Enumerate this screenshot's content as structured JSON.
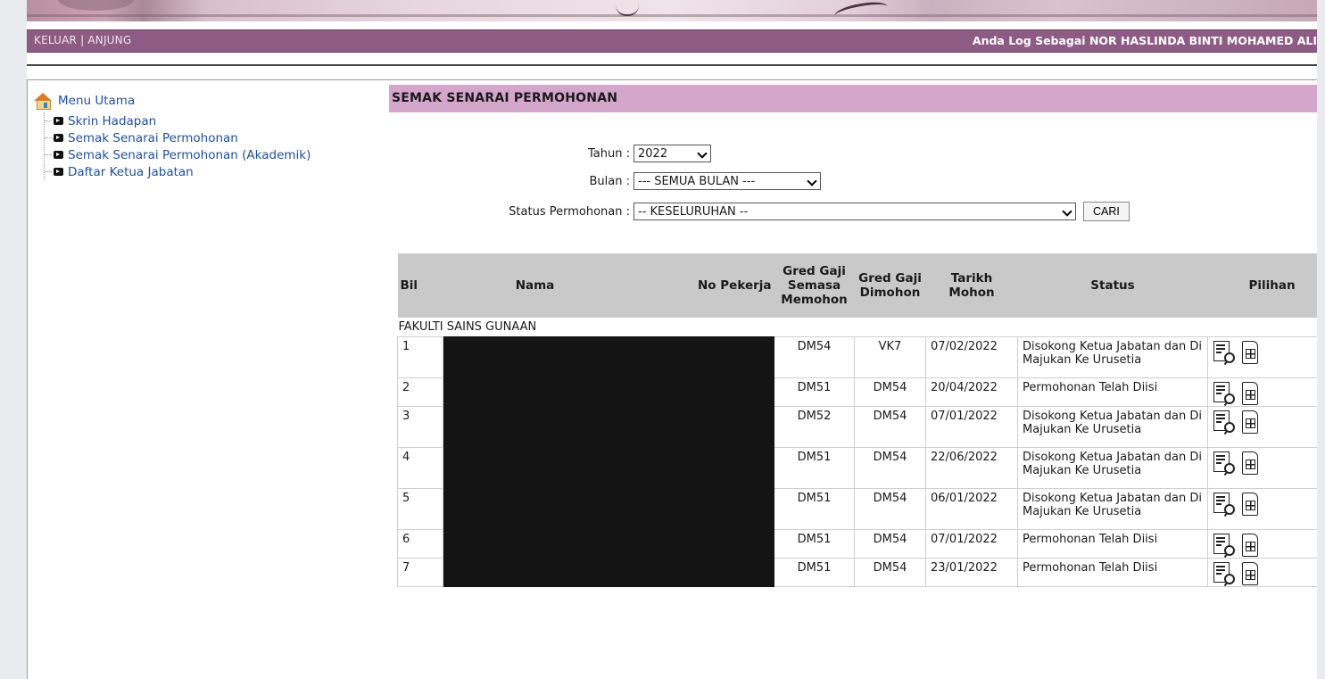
{
  "topbar": {
    "link_keluar": "KELUAR",
    "separator": " | ",
    "link_anjung": "ANJUNG",
    "login_text": "Anda Log Sebagai NOR HASLINDA BINTI MOHAMED ALI"
  },
  "sidebar": {
    "root": "Menu Utama",
    "items": [
      {
        "label": "Skrin Hadapan"
      },
      {
        "label": "Semak Senarai Permohonan"
      },
      {
        "label": "Semak Senarai Permohonan (Akademik)"
      },
      {
        "label": "Daftar Ketua Jabatan"
      }
    ]
  },
  "main": {
    "title": "SEMAK SENARAI PERMOHONAN",
    "filters": {
      "tahun_label": "Tahun :",
      "tahun_value": "2022",
      "bulan_label": "Bulan :",
      "bulan_value": "--- SEMUA BULAN ---",
      "status_label": "Status Permohonan :",
      "status_value": "-- KESELURUHAN --",
      "search_button": "CARI"
    },
    "table": {
      "headers": {
        "bil": "Bil",
        "nama": "Nama",
        "no_pekerja": "No Pekerja",
        "gred_semasa_1": "Gred Gaji",
        "gred_semasa_2": "Semasa",
        "gred_semasa_3": "Memohon",
        "gred_dimohon_1": "Gred Gaji",
        "gred_dimohon_2": "Dimohon",
        "tarikh_1": "Tarikh",
        "tarikh_2": "Mohon",
        "status": "Status",
        "pilihan": "Pilihan"
      },
      "group": "FAKULTI SAINS GUNAAN",
      "rows": [
        {
          "bil": "1",
          "gred_semasa": "DM54",
          "gred_dimohon": "VK7",
          "tarikh": "07/02/2022",
          "status": "Disokong Ketua Jabatan dan Di Majukan Ke Urusetia"
        },
        {
          "bil": "2",
          "gred_semasa": "DM51",
          "gred_dimohon": "DM54",
          "tarikh": "20/04/2022",
          "status": "Permohonan Telah Diisi"
        },
        {
          "bil": "3",
          "gred_semasa": "DM52",
          "gred_dimohon": "DM54",
          "tarikh": "07/01/2022",
          "status": "Disokong Ketua Jabatan dan Di Majukan Ke Urusetia"
        },
        {
          "bil": "4",
          "gred_semasa": "DM51",
          "gred_dimohon": "DM54",
          "tarikh": "22/06/2022",
          "status": "Disokong Ketua Jabatan dan Di Majukan Ke Urusetia"
        },
        {
          "bil": "5",
          "gred_semasa": "DM51",
          "gred_dimohon": "DM54",
          "tarikh": "06/01/2022",
          "status": "Disokong Ketua Jabatan dan Di Majukan Ke Urusetia"
        },
        {
          "bil": "6",
          "gred_semasa": "DM51",
          "gred_dimohon": "DM54",
          "tarikh": "07/01/2022",
          "status": "Permohonan Telah Diisi"
        },
        {
          "bil": "7",
          "gred_semasa": "DM51",
          "gred_dimohon": "DM54",
          "tarikh": "23/01/2022",
          "status": "Permohonan Telah Diisi"
        }
      ]
    }
  },
  "colors": {
    "topbar": "#8e5b84",
    "title_bar": "#d5a6cc",
    "header_bg": "#c9c9c9",
    "link": "#1f4e9a"
  },
  "icons": {
    "home": "home-icon",
    "bullet": "bullet-arrow-icon",
    "view": "document-search-icon",
    "report": "document-grid-icon"
  }
}
